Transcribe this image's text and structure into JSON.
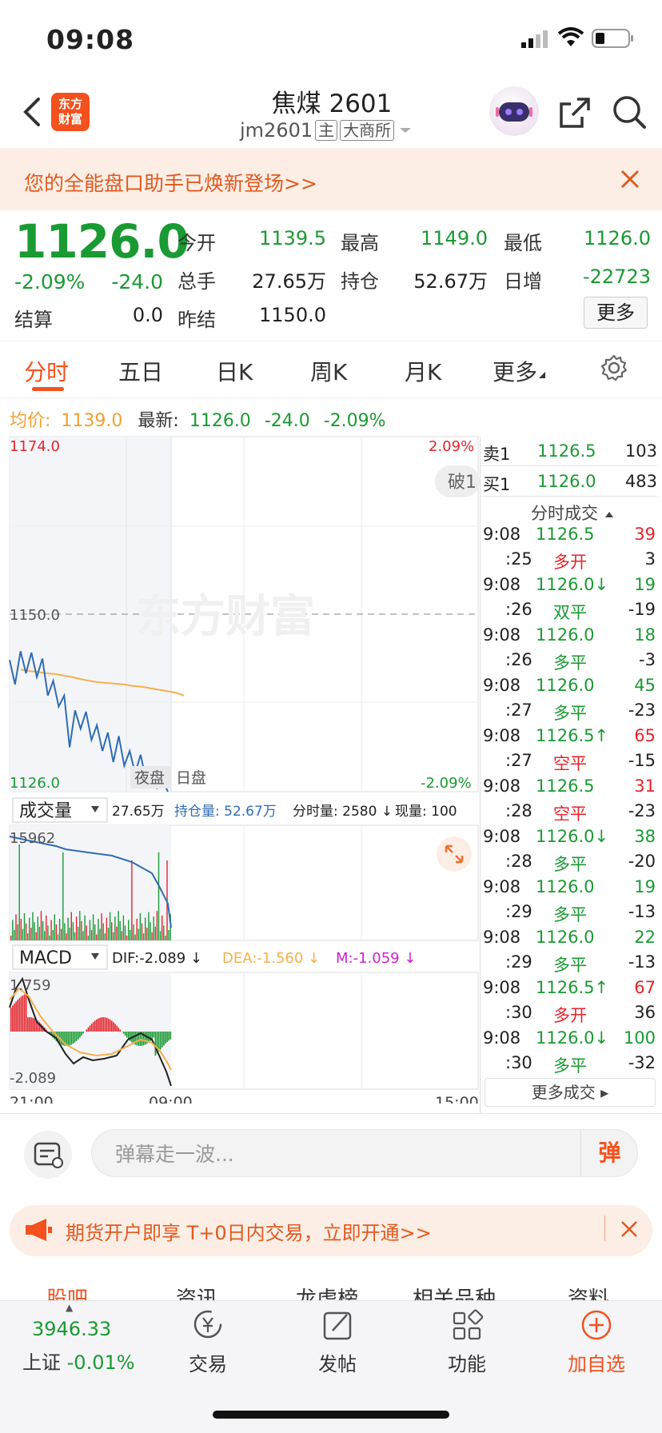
{
  "status": {
    "time": "09:08"
  },
  "header": {
    "title": "焦煤 2601",
    "code": "jm2601",
    "tag_main": "主",
    "tag_exchange": "大商所",
    "logo_line1": "东方",
    "logo_line2": "财富"
  },
  "banner": {
    "text": "您的全能盘口助手已焕新登场>>"
  },
  "quote": {
    "price": "1126.0",
    "change_pct": "-2.09%",
    "change": "-24.0",
    "settle_label": "结算",
    "settle": "0.0",
    "open_label": "今开",
    "open": "1139.5",
    "high_label": "最高",
    "high": "1149.0",
    "low_label": "最低",
    "low": "1126.0",
    "volume_label": "总手",
    "volume": "27.65万",
    "oi_label": "持仓",
    "oi": "52.67万",
    "daily_inc_label": "日增",
    "daily_inc": "-22723",
    "prev_settle_label": "昨结",
    "prev_settle": "1150.0",
    "more_label": "更多"
  },
  "tabs": [
    "分时",
    "五日",
    "日K",
    "周K",
    "月K",
    "更多"
  ],
  "avg_row": {
    "avg_label": "均价:",
    "avg": "1139.0",
    "latest_label": "最新:",
    "latest": "1126.0",
    "chg": "-24.0",
    "pct": "-2.09%"
  },
  "chart": {
    "price_top": "1174.0",
    "pct_top": "2.09%",
    "price_mid": "1150.0",
    "price_bottom": "1126.0",
    "pct_bottom": "-2.09%",
    "watermark": "东方财富",
    "night_label": "夜盘",
    "day_label": "日盘",
    "break_label": "破1",
    "vol_selector": "成交量",
    "vol_total": "27.65万",
    "vol_oi": "持仓量: 52.67万",
    "vol_tick": "分时量: 2580 ↓",
    "vol_now": "现量: 100",
    "vol_max": "15962",
    "macd_selector": "MACD",
    "dif": "DIF:-2.089 ↓",
    "dea": "DEA:-1.560 ↓",
    "m": "M:-1.059 ↓",
    "macd_top": "1.759",
    "macd_bottom": "-2.089",
    "time_start": "21:00",
    "time_mid": "09:00",
    "time_end": "15:00"
  },
  "chart_data": {
    "type": "line",
    "series": [
      {
        "name": "最新",
        "values": [
          1143.8,
          1140.5,
          1145.0,
          1142.0,
          1144.8,
          1141.5,
          1144.0,
          1139.0,
          1141.0,
          1137.5,
          1139.0,
          1132.0,
          1137.0,
          1134.5,
          1136.8,
          1133.0,
          1135.0,
          1131.5,
          1134.0,
          1130.0,
          1133.5,
          1129.5,
          1131.5,
          1128.5,
          1131.0,
          1127.5,
          1129.0,
          1126.5,
          1127.5,
          1126.0
        ]
      },
      {
        "name": "均价",
        "values": [
          1142.5,
          1142.3,
          1142.2,
          1142.0,
          1141.9,
          1141.7,
          1141.5,
          1141.2,
          1141.0,
          1140.8,
          1140.7,
          1140.6,
          1140.5,
          1140.3,
          1140.2,
          1140.0,
          1139.8,
          1139.6,
          1139.4,
          1139.0
        ]
      }
    ],
    "ylim": [
      1126.0,
      1174.0
    ]
  },
  "order_book": {
    "ask_label": "卖1",
    "ask_price": "1126.5",
    "ask_vol": "103",
    "bid_label": "买1",
    "bid_price": "1126.0",
    "bid_vol": "483",
    "trades_header": "分时成交",
    "trades": [
      {
        "t": "9:08",
        "p": "1126.5",
        "v": "39",
        "s": ":25",
        "type": "多开",
        "n": "3",
        "pc": "green",
        "vc": "red",
        "tc": "red"
      },
      {
        "t": "9:08",
        "p": "1126.0↓",
        "v": "19",
        "s": ":26",
        "type": "双平",
        "n": "-19",
        "pc": "green",
        "vc": "green",
        "tc": "green"
      },
      {
        "t": "9:08",
        "p": "1126.0",
        "v": "18",
        "s": ":26",
        "type": "多平",
        "n": "-3",
        "pc": "green",
        "vc": "green",
        "tc": "green"
      },
      {
        "t": "9:08",
        "p": "1126.0",
        "v": "45",
        "s": ":27",
        "type": "多平",
        "n": "-23",
        "pc": "green",
        "vc": "green",
        "tc": "green"
      },
      {
        "t": "9:08",
        "p": "1126.5↑",
        "v": "65",
        "s": ":27",
        "type": "空平",
        "n": "-15",
        "pc": "green",
        "vc": "red",
        "tc": "red"
      },
      {
        "t": "9:08",
        "p": "1126.5",
        "v": "31",
        "s": ":28",
        "type": "空平",
        "n": "-23",
        "pc": "green",
        "vc": "red",
        "tc": "red"
      },
      {
        "t": "9:08",
        "p": "1126.0↓",
        "v": "38",
        "s": ":28",
        "type": "多平",
        "n": "-20",
        "pc": "green",
        "vc": "green",
        "tc": "green"
      },
      {
        "t": "9:08",
        "p": "1126.0",
        "v": "19",
        "s": ":29",
        "type": "多平",
        "n": "-13",
        "pc": "green",
        "vc": "green",
        "tc": "green"
      },
      {
        "t": "9:08",
        "p": "1126.0",
        "v": "22",
        "s": ":29",
        "type": "多平",
        "n": "-13",
        "pc": "green",
        "vc": "green",
        "tc": "green"
      },
      {
        "t": "9:08",
        "p": "1126.5↑",
        "v": "67",
        "s": ":30",
        "type": "多开",
        "n": "36",
        "pc": "green",
        "vc": "red",
        "tc": "red"
      },
      {
        "t": "9:08",
        "p": "1126.0↓",
        "v": "100",
        "s": ":30",
        "type": "多平",
        "n": "-32",
        "pc": "green",
        "vc": "green",
        "tc": "green"
      }
    ],
    "more_trades": "更多成交"
  },
  "chat": {
    "placeholder": "弹幕走一波...",
    "send": "弹"
  },
  "promo": {
    "text": "期货开户即享 T+0日内交易，立即开通>>"
  },
  "subtabs": [
    "股吧",
    "资讯",
    "龙虎榜",
    "相关品种",
    "资料"
  ],
  "bottom_nav": {
    "index_value": "3946.33",
    "index_name": "上证",
    "index_change": "-0.01%",
    "trade": "交易",
    "post": "发帖",
    "functions": "功能",
    "add_watch": "加自选"
  },
  "colors": {
    "up": "#e5242b",
    "down": "#1a9a33",
    "accent": "#f4511e",
    "avg_line": "#f5b04a",
    "price_line": "#2e6db5"
  }
}
